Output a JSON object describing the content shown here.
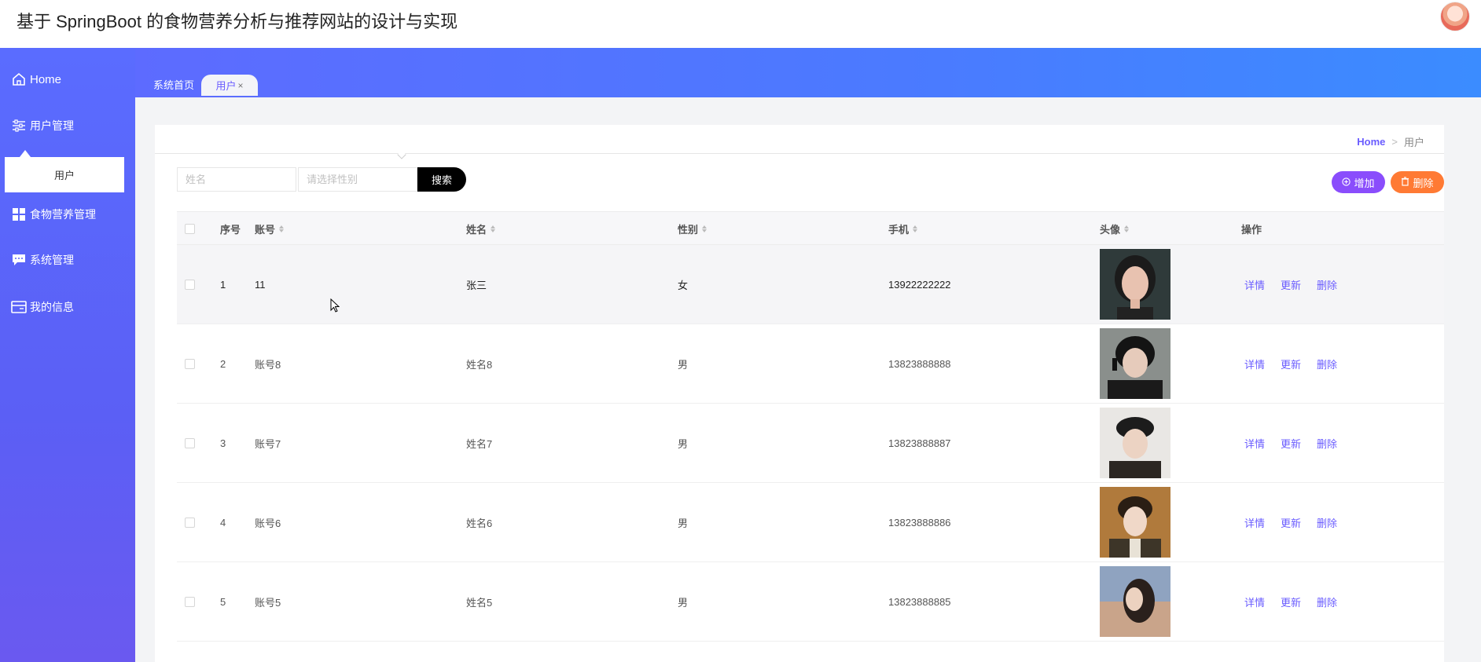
{
  "app": {
    "title": "基于 SpringBoot 的食物营养分析与推荐网站的设计与实现"
  },
  "sidebar": {
    "items": [
      {
        "label": "Home",
        "icon": "home-icon"
      },
      {
        "label": "用户管理",
        "icon": "sliders-icon"
      },
      {
        "label": "食物营养管理",
        "icon": "grid-icon"
      },
      {
        "label": "系统管理",
        "icon": "chat-icon"
      },
      {
        "label": "我的信息",
        "icon": "id-card-icon"
      }
    ],
    "sub_item": "用户"
  },
  "tabs": {
    "home": "系统首页",
    "user": "用户",
    "close_glyph": "×"
  },
  "breadcrumb": {
    "home": "Home",
    "separator": ">",
    "current": "用户"
  },
  "search": {
    "name_placeholder": "姓名",
    "sex_placeholder": "请选择性别",
    "button": "搜索"
  },
  "actions": {
    "add": "增加",
    "delete": "删除"
  },
  "table": {
    "headers": {
      "index": "序号",
      "account": "账号",
      "name": "姓名",
      "sex": "性别",
      "phone": "手机",
      "avatar": "头像",
      "ops": "操作"
    },
    "ops": {
      "detail": "详情",
      "update": "更新",
      "delete": "删除"
    },
    "rows": [
      {
        "index": "1",
        "account": "11",
        "name": "张三",
        "sex": "女",
        "phone": "13922222222"
      },
      {
        "index": "2",
        "account": "账号8",
        "name": "姓名8",
        "sex": "男",
        "phone": "13823888888"
      },
      {
        "index": "3",
        "account": "账号7",
        "name": "姓名7",
        "sex": "男",
        "phone": "13823888887"
      },
      {
        "index": "4",
        "account": "账号6",
        "name": "姓名6",
        "sex": "男",
        "phone": "13823888886"
      },
      {
        "index": "5",
        "account": "账号5",
        "name": "姓名5",
        "sex": "男",
        "phone": "13823888885"
      }
    ]
  },
  "colors": {
    "accent": "#6a5cff",
    "sidebar": "#5b5ff5",
    "add_button": "#8a4dfc",
    "delete_button": "#ff7a34",
    "search_button": "#000000"
  }
}
